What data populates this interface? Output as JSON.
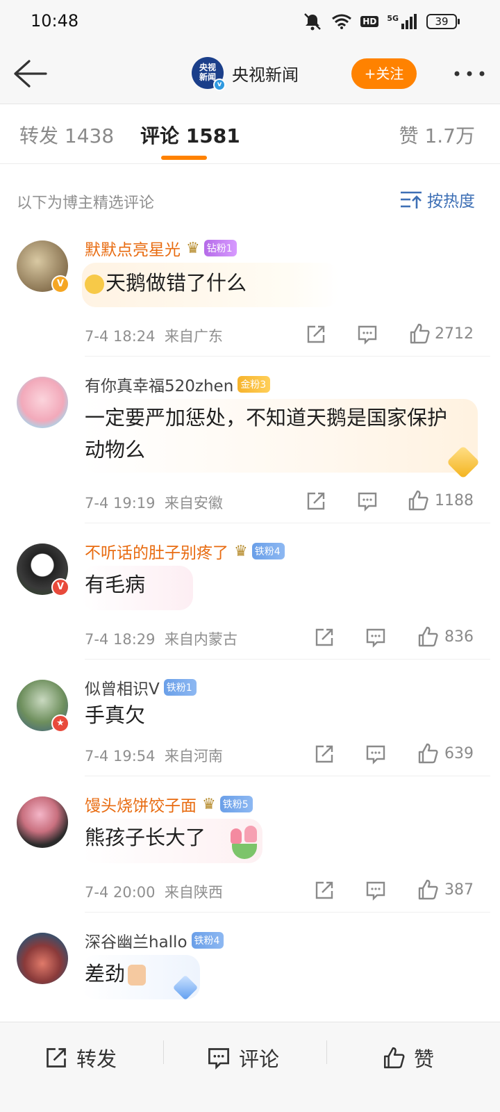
{
  "status": {
    "time": "10:48",
    "battery": "39",
    "icons": [
      "mute-icon",
      "wifi-icon",
      "hd-icon",
      "5g-signal-icon"
    ],
    "hd_label": "HD",
    "net_label": "5G"
  },
  "header": {
    "back_icon": "arrow-left-icon",
    "account_name": "央视新闻",
    "logo_text": "央视新闻",
    "verified_mark": "v",
    "follow_label": "+关注",
    "more_icon": "more-dots-icon"
  },
  "tabs": {
    "repost": "转发 1438",
    "comment": "评论 1581",
    "like": "赞 1.7万",
    "accent": "#ff8200"
  },
  "filter": {
    "note": "以下为博主精选评论",
    "sort_label": "按热度"
  },
  "comments": [
    {
      "user": "默默点亮星光",
      "fan": "钻粉1",
      "text": "天鹅做错了什么",
      "time": "7-4 18:24",
      "location": "来自广东",
      "likes": "2712"
    },
    {
      "user": "有你真幸福520zhen",
      "fan": "金粉3",
      "text": "一定要严加惩处，不知道天鹅是国家保护动物么",
      "time": "7-4 19:19",
      "location": "来自安徽",
      "likes": "1188"
    },
    {
      "user": "不听话的肚子别疼了",
      "fan": "铁粉4",
      "text": "有毛病",
      "time": "7-4 18:29",
      "location": "来自内蒙古",
      "likes": "836"
    },
    {
      "user": "似曾相识V",
      "fan": "铁粉1",
      "text": "手真欠",
      "time": "7-4 19:54",
      "location": "来自河南",
      "likes": "639"
    },
    {
      "user": "馒头烧饼饺子面",
      "fan": "铁粉5",
      "text": "熊孩子长大了",
      "time": "7-4 20:00",
      "location": "来自陕西",
      "likes": "387"
    },
    {
      "user": "深谷幽兰hallo",
      "fan": "铁粉4",
      "text": "差劲",
      "time": "",
      "location": "",
      "likes": ""
    }
  ],
  "bottom": {
    "repost": "转发",
    "comment": "评论",
    "like": "赞"
  },
  "colors": {
    "vip_name": "#e86b10",
    "link": "#3d6fb5",
    "follow_bg": "#ff8200"
  }
}
